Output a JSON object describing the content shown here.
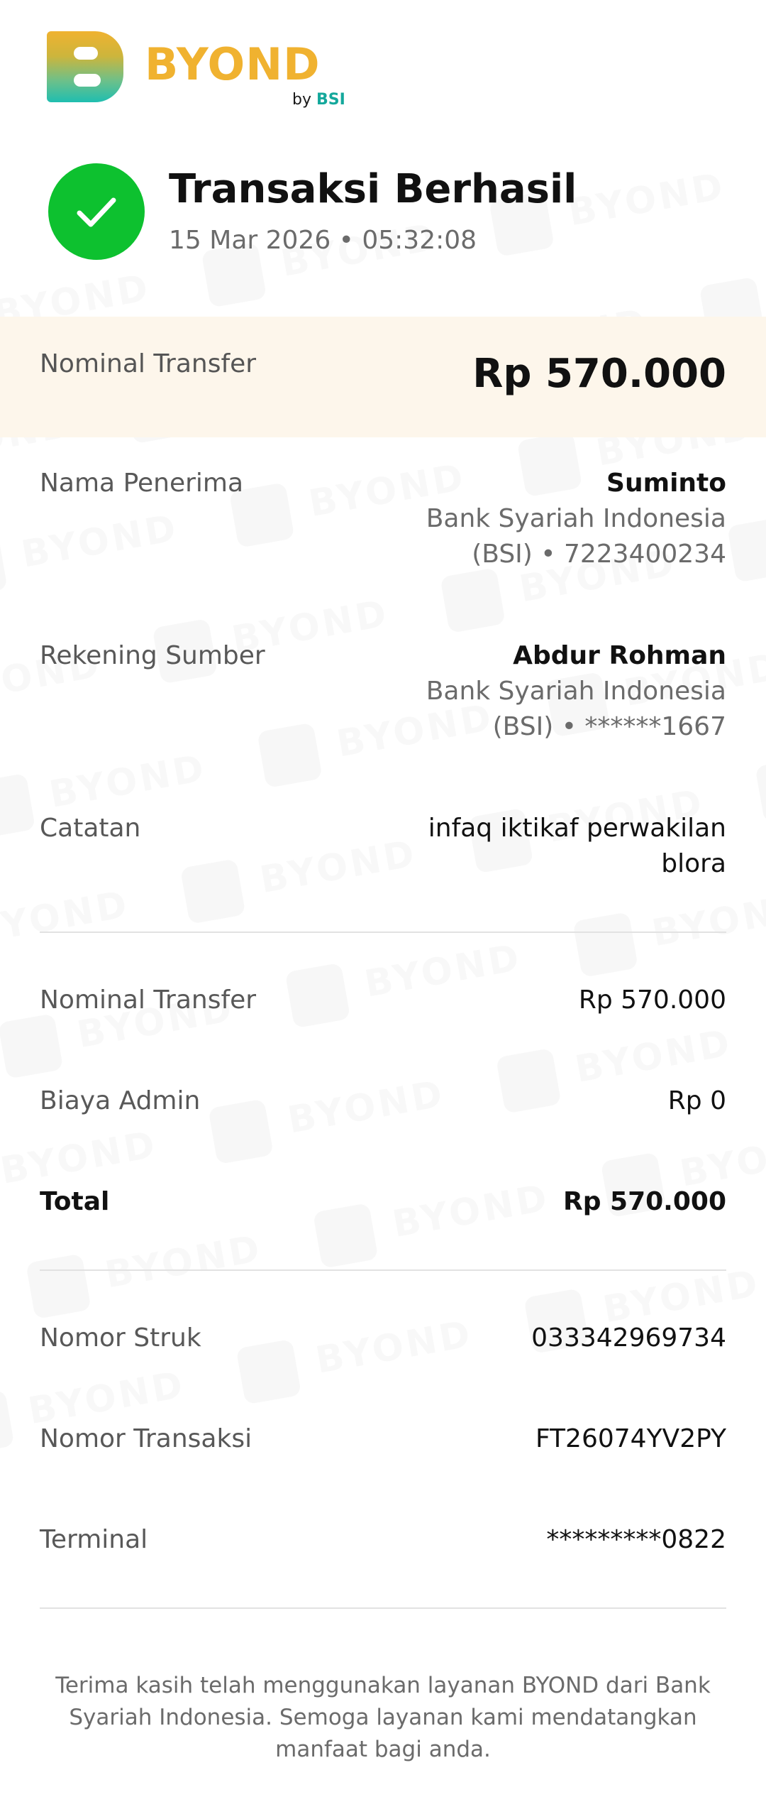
{
  "brand": {
    "name": "BYOND",
    "sub_prefix": "by",
    "sub_brand": "BSI"
  },
  "status": {
    "title": "Transaksi Berhasil",
    "datetime": "15 Mar 2026 • 05:32:08"
  },
  "amount": {
    "label": "Nominal Transfer",
    "value": "Rp 570.000"
  },
  "recipient": {
    "label": "Nama Penerima",
    "name": "Suminto",
    "detail": "Bank Syariah Indonesia (BSI) • 7223400234"
  },
  "source": {
    "label": "Rekening Sumber",
    "name": "Abdur Rohman",
    "detail": "Bank Syariah Indonesia (BSI) • ******1667"
  },
  "note": {
    "label": "Catatan",
    "value": "infaq iktikaf perwakilan blora"
  },
  "breakdown": {
    "transfer_label": "Nominal Transfer",
    "transfer_value": "Rp 570.000",
    "admin_label": "Biaya Admin",
    "admin_value": "Rp 0",
    "total_label": "Total",
    "total_value": "Rp 570.000"
  },
  "reference": {
    "receipt_label": "Nomor Struk",
    "receipt_value": "033342969734",
    "transaction_label": "Nomor Transaksi",
    "transaction_value": "FT26074YV2PY",
    "terminal_label": "Terminal",
    "terminal_value": "*********0822"
  },
  "footer": {
    "message": "Terima kasih telah menggunakan layanan BYOND dari Bank Syariah Indonesia. Semoga layanan kami mendatangkan manfaat bagi anda."
  },
  "colors": {
    "success": "#0dc12f",
    "brand_yellow": "#f0b230",
    "brand_teal": "#1fbeb0",
    "amount_band": "#fdf5e9"
  }
}
